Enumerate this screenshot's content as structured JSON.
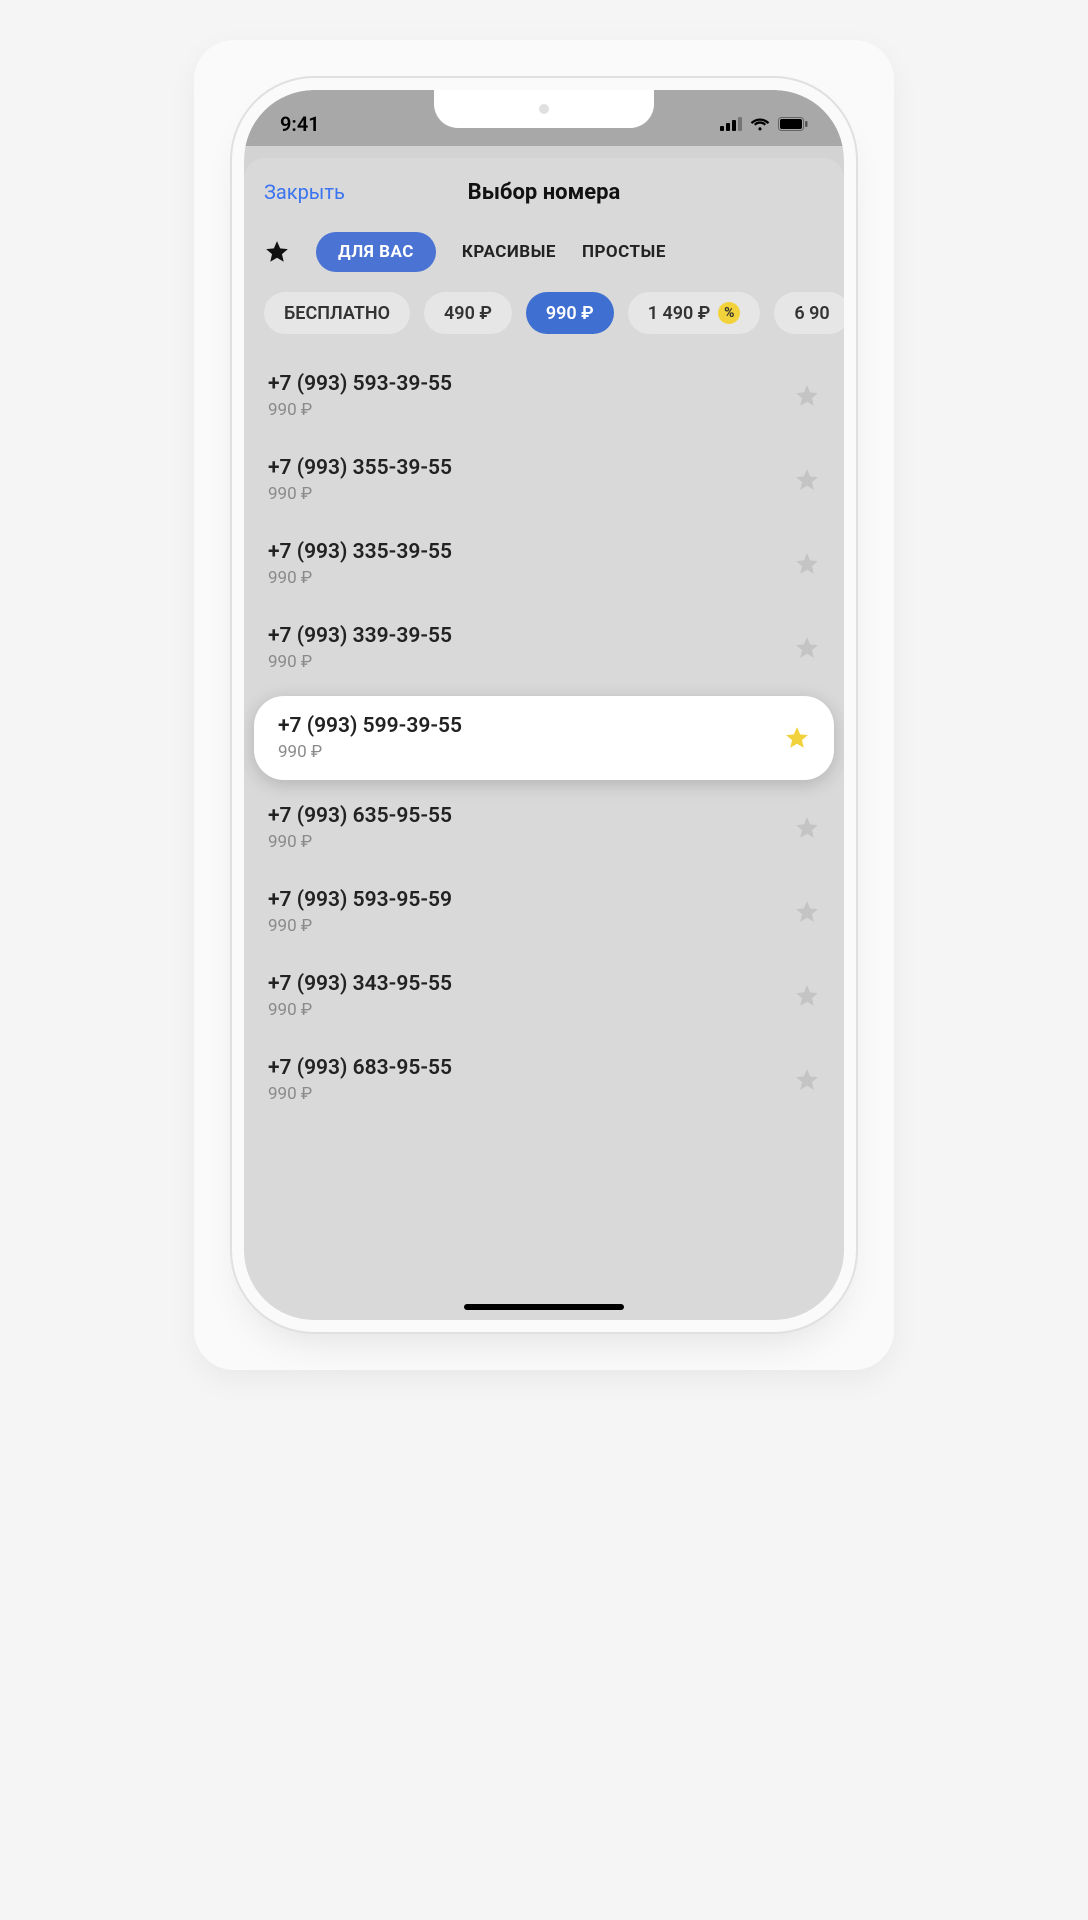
{
  "status": {
    "time": "9:41"
  },
  "header": {
    "close": "Закрыть",
    "title": "Выбор номера"
  },
  "tabs": {
    "for_you": "ДЛЯ ВАС",
    "pretty": "КРАСИВЫЕ",
    "simple": "ПРОСТЫЕ"
  },
  "price_filters": {
    "free": "БЕСПЛАТНО",
    "p490": "490 ₽",
    "p990": "990 ₽",
    "p1490": "1 490 ₽",
    "p6900": "6 90",
    "discount_symbol": "%"
  },
  "numbers": [
    {
      "phone": "+7 (993) 593-39-55",
      "price": "990 ₽",
      "fav": false
    },
    {
      "phone": "+7 (993) 355-39-55",
      "price": "990 ₽",
      "fav": false
    },
    {
      "phone": "+7 (993) 335-39-55",
      "price": "990 ₽",
      "fav": false
    },
    {
      "phone": "+7 (993) 339-39-55",
      "price": "990 ₽",
      "fav": false
    },
    {
      "phone": "+7 (993) 599-39-55",
      "price": "990 ₽",
      "fav": true
    },
    {
      "phone": "+7 (993) 635-95-55",
      "price": "990 ₽",
      "fav": false
    },
    {
      "phone": "+7 (993) 593-95-59",
      "price": "990 ₽",
      "fav": false
    },
    {
      "phone": "+7 (993) 343-95-55",
      "price": "990 ₽",
      "fav": false
    },
    {
      "phone": "+7 (993) 683-95-55",
      "price": "990 ₽",
      "fav": false
    }
  ]
}
